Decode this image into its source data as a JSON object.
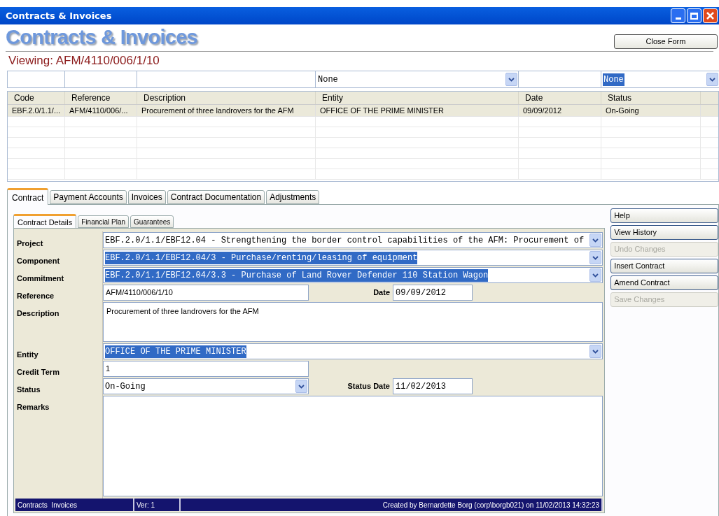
{
  "window": {
    "title": "Contracts & Invoices"
  },
  "header": {
    "title": "Contracts & Invoices",
    "close_button": "Close Form",
    "viewing": "Viewing: AFM/4110/006/1/10"
  },
  "filters": [
    {
      "kind": "field"
    },
    {
      "kind": "field"
    },
    {
      "kind": "field"
    },
    {
      "kind": "dropdown",
      "value": "None",
      "highlighted": false
    },
    {
      "kind": "field"
    },
    {
      "kind": "dropdown",
      "value": "None",
      "highlighted": true
    }
  ],
  "table": {
    "columns": [
      "Code",
      "Reference",
      "Description",
      "Entity",
      "Date",
      "Status"
    ],
    "rows": [
      {
        "selected": true,
        "cells": [
          "EBF.2.0/1.1/...",
          "AFM/4110/006/...",
          "Procurement of three landrovers for the AFM",
          "OFFICE OF THE PRIME MINISTER",
          "09/09/2012",
          "On-Going"
        ]
      }
    ]
  },
  "tabs": [
    {
      "label": "Contract",
      "selected": true
    },
    {
      "label": "Payment Accounts",
      "selected": false
    },
    {
      "label": "Invoices",
      "selected": false
    },
    {
      "label": "Contract Documentation",
      "selected": false
    },
    {
      "label": "Adjustments",
      "selected": false
    }
  ],
  "subtabs": [
    {
      "label": "Contract Details",
      "selected": true
    },
    {
      "label": "Financial Plan",
      "selected": false
    },
    {
      "label": "Guarantees",
      "selected": false
    }
  ],
  "form": [
    {
      "label": "Project",
      "kind": "dropdown",
      "value": "EBF.2.0/1.1/EBF12.04 - Strengthening the border control capabilities of the AFM: Procurement of",
      "highlighted": false
    },
    {
      "label": "Component",
      "kind": "dropdown",
      "value": "EBF.2.0/1.1/EBF12.04/3 - Purchase/renting/leasing of equipment",
      "highlighted": true
    },
    {
      "label": "Commitment",
      "kind": "dropdown",
      "value": "EBF.2.0/1.1/EBF12.04/3.3 - Purchase of Land Rover Defender 110 Station Wagon",
      "highlighted": true
    },
    {
      "label": "Reference",
      "kind": "text",
      "value": "AFM/4110/006/1/10",
      "side": {
        "label": "Date",
        "value": "09/09/2012"
      }
    },
    {
      "label": "Description",
      "kind": "textarea",
      "value": "Procurement of three landrovers for the AFM"
    },
    {
      "label": "Entity",
      "kind": "dropdown",
      "value": "OFFICE OF THE PRIME MINISTER",
      "highlighted": true
    },
    {
      "label": "Credit Term",
      "kind": "text",
      "value": "1"
    },
    {
      "label": "Status",
      "kind": "halfdropdown",
      "value": "On-Going",
      "highlighted": false,
      "side": {
        "label": "Status Date",
        "value": "11/02/2013"
      }
    },
    {
      "label": "Remarks",
      "kind": "bigarea"
    }
  ],
  "actions": [
    {
      "label": "Help",
      "disabled": false
    },
    {
      "label": "View History",
      "disabled": false
    },
    {
      "label": "Undo Changes",
      "disabled": true
    },
    {
      "label": "Insert Contract",
      "disabled": false
    },
    {
      "label": "Amend Contract",
      "disabled": false
    },
    {
      "label": "Save Changes",
      "disabled": true
    }
  ],
  "status_bar": [
    "Contracts  Invoices",
    "Ver: 1",
    "Created by Bernardette Borg (corp\\borgb021) on 11/02/2013 14:32:23"
  ]
}
